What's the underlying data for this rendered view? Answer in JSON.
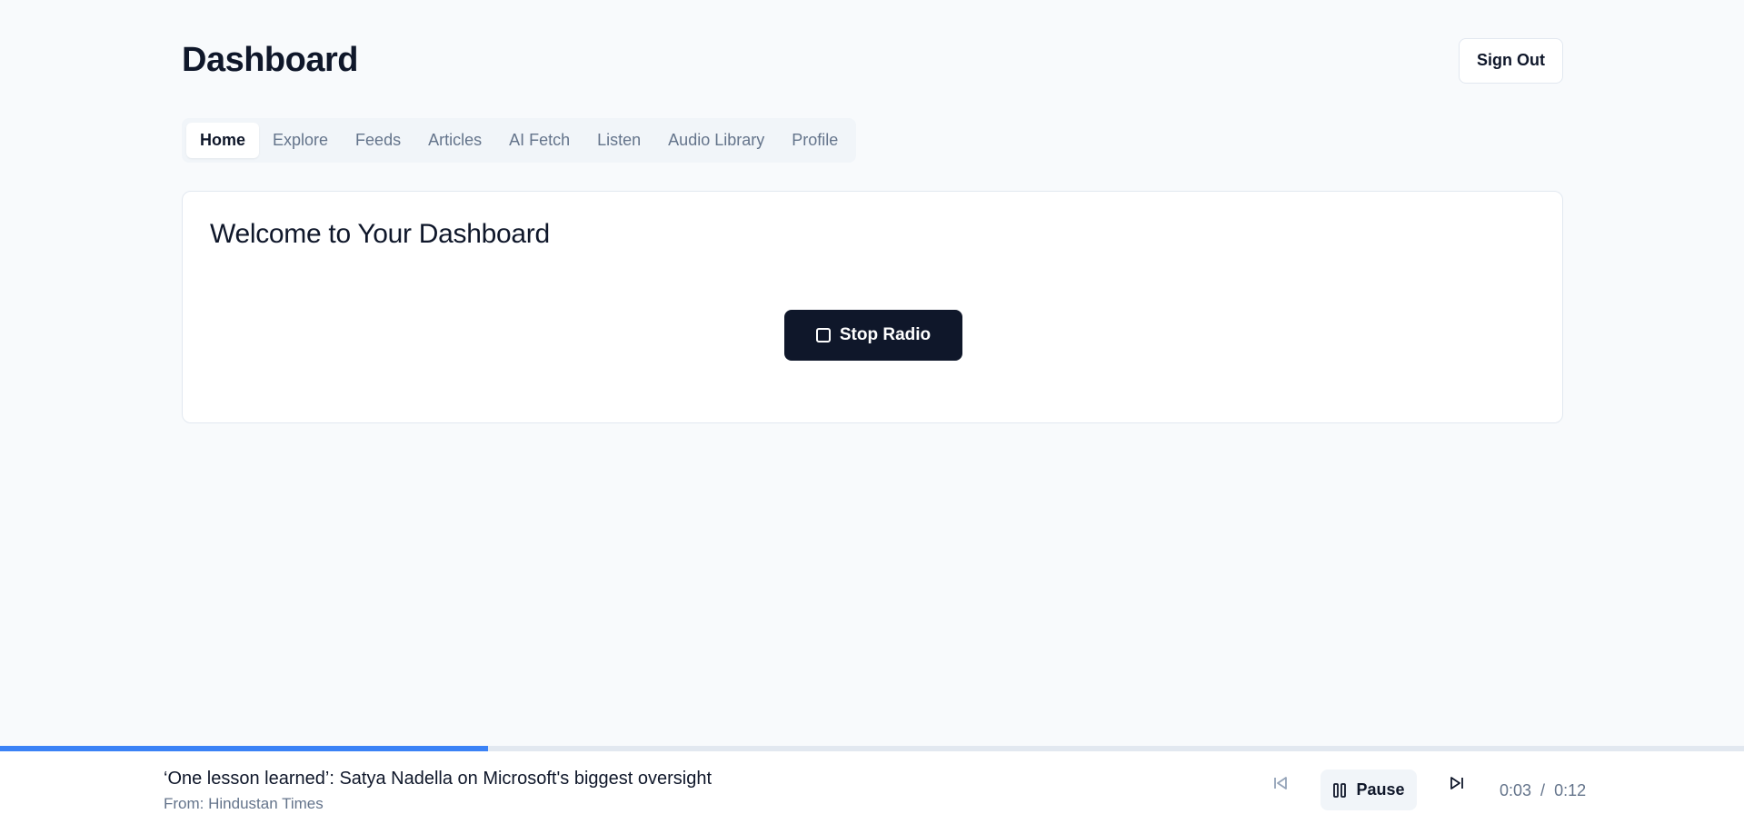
{
  "header": {
    "title": "Dashboard",
    "sign_out_label": "Sign Out"
  },
  "tabs": [
    {
      "label": "Home",
      "active": true
    },
    {
      "label": "Explore",
      "active": false
    },
    {
      "label": "Feeds",
      "active": false
    },
    {
      "label": "Articles",
      "active": false
    },
    {
      "label": "AI Fetch",
      "active": false
    },
    {
      "label": "Listen",
      "active": false
    },
    {
      "label": "Audio Library",
      "active": false
    },
    {
      "label": "Profile",
      "active": false
    }
  ],
  "main": {
    "card_title": "Welcome to Your Dashboard",
    "stop_radio_label": "Stop Radio",
    "stop_icon": "square-icon"
  },
  "player": {
    "track_title": "‘One lesson learned’: Satya Nadella on Microsoft's biggest oversight",
    "track_source": "From: Hindustan Times",
    "pause_label": "Pause",
    "current_time": "0:03",
    "time_separator": "/",
    "duration": "0:12",
    "progress_fraction": 0.28,
    "icons": {
      "previous": "skip-back-icon",
      "pause": "pause-icon",
      "next": "skip-forward-icon"
    }
  },
  "colors": {
    "background": "#f8fafc",
    "primary_dark": "#0f172a",
    "accent_progress": "#3b82f6",
    "muted_text": "#64748b"
  }
}
